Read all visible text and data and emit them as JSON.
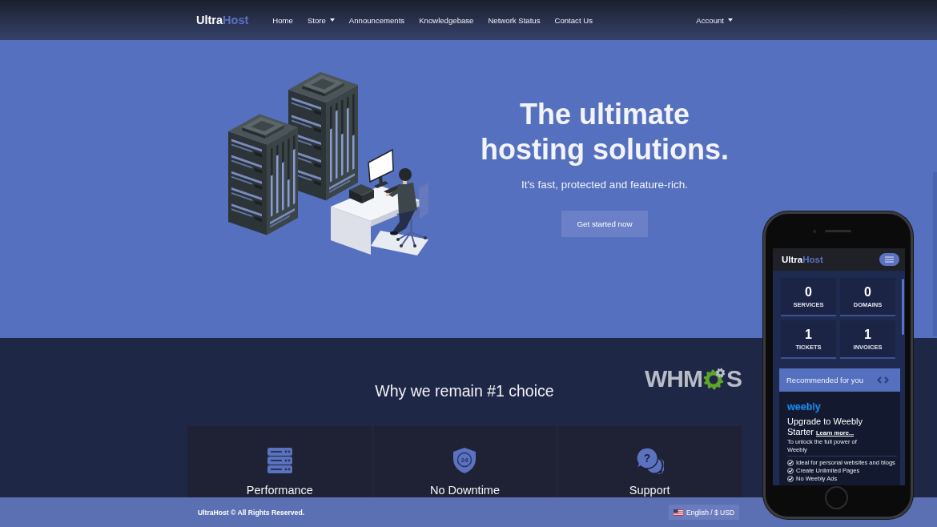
{
  "navbar": {
    "logo": {
      "primary": "Ultra",
      "accent": "Host"
    },
    "links": [
      {
        "label": "Home",
        "dropdown": false
      },
      {
        "label": "Store",
        "dropdown": true
      },
      {
        "label": "Announcements",
        "dropdown": false
      },
      {
        "label": "Knowledgebase",
        "dropdown": false
      },
      {
        "label": "Network Status",
        "dropdown": false
      },
      {
        "label": "Contact Us",
        "dropdown": false
      }
    ],
    "account": {
      "label": "Account",
      "dropdown": true
    }
  },
  "hero": {
    "title": "The ultimate hosting solutions.",
    "subtitle": "It's fast, protected and feature-rich.",
    "button": "Get started now"
  },
  "features_section": {
    "heading": "Why we remain #1 choice",
    "partner_logo": {
      "before": "WHM",
      "after": "S"
    },
    "features": [
      {
        "kind": "servers",
        "title": "Performance"
      },
      {
        "kind": "shield",
        "icon_text": "24",
        "title": "No Downtime"
      },
      {
        "kind": "chat",
        "icon_text": "?",
        "title": "Support"
      }
    ]
  },
  "footer": {
    "copyright": "UltraHost © All Rights Reserved.",
    "language_button": "English / $ USD"
  },
  "phone": {
    "logo": {
      "primary": "Ultra",
      "accent": "Host"
    },
    "stats": [
      {
        "value": "0",
        "label": "SERVICES"
      },
      {
        "value": "0",
        "label": "DOMAINS"
      },
      {
        "value": "1",
        "label": "TICKETS"
      },
      {
        "value": "1",
        "label": "INVOICES"
      }
    ],
    "recommended": {
      "heading": "Recommended for you",
      "brand": "weebly",
      "title": "Upgrade to Weebly Starter",
      "link": "Learn more...",
      "description": "To unlock the full power of Weebly",
      "features": [
        "Ideal for personal websites and blogs",
        "Create Unlimited Pages",
        "No Weebly Ads"
      ]
    }
  }
}
